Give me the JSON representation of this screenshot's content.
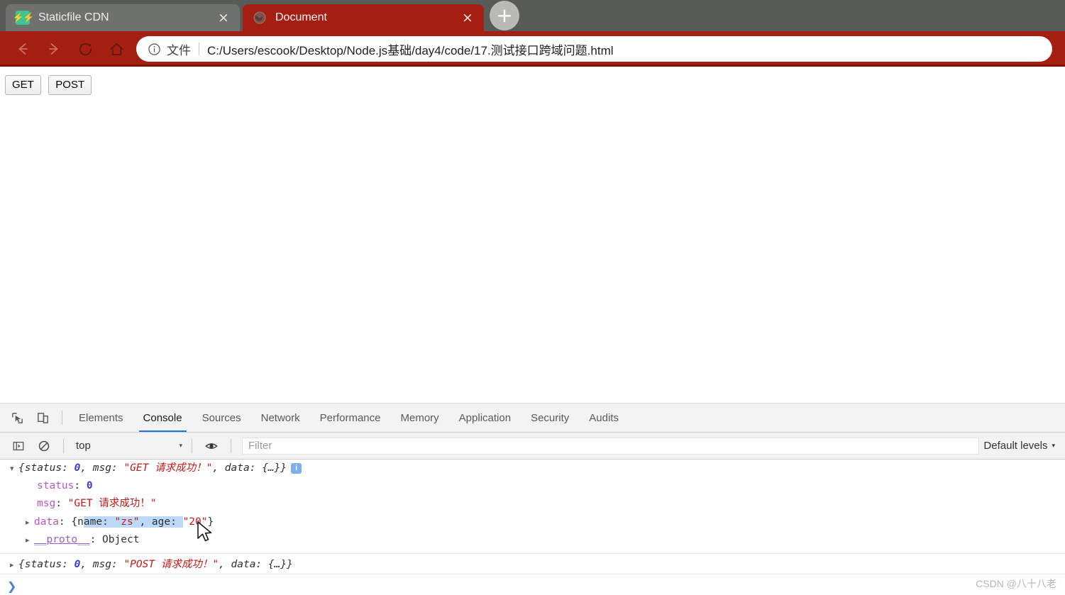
{
  "window": {
    "tabs": [
      {
        "title": "Staticfile CDN",
        "favicon": "lightning-icon",
        "active": false,
        "close_label": "×"
      },
      {
        "title": "Document",
        "favicon": "globe-icon",
        "active": true,
        "close_label": "×"
      }
    ],
    "new_tab_label": "+"
  },
  "toolbar": {
    "back_icon": "arrow-left-icon",
    "forward_icon": "arrow-right-icon",
    "reload_icon": "reload-icon",
    "home_icon": "home-icon",
    "omnibox": {
      "info_icon": "info-circle-icon",
      "scheme_label": "文件",
      "url": "C:/Users/escook/Desktop/Node.js基础/day4/code/17.测试接口跨域问题.html"
    }
  },
  "page": {
    "buttons": [
      {
        "label": "GET"
      },
      {
        "label": "POST"
      }
    ]
  },
  "devtools": {
    "inspect_icon": "inspect-element-icon",
    "device_icon": "device-toolbar-icon",
    "tabs": [
      {
        "label": "Elements",
        "active": false
      },
      {
        "label": "Console",
        "active": true
      },
      {
        "label": "Sources",
        "active": false
      },
      {
        "label": "Network",
        "active": false
      },
      {
        "label": "Performance",
        "active": false
      },
      {
        "label": "Memory",
        "active": false
      },
      {
        "label": "Application",
        "active": false
      },
      {
        "label": "Security",
        "active": false
      },
      {
        "label": "Audits",
        "active": false
      }
    ],
    "console_toolbar": {
      "sidebar_icon": "console-sidebar-icon",
      "clear_icon": "clear-console-icon",
      "context": "top",
      "context_caret": "▾",
      "eye_icon": "live-expression-eye-icon",
      "filter_placeholder": "Filter",
      "filter_value": "",
      "levels_label": "Default levels",
      "levels_caret": "▾"
    },
    "console": {
      "entry1": {
        "toggle": "▾",
        "preview_open": "{",
        "k_status": "status: ",
        "v_status": "0",
        "comma1": ", ",
        "k_msg": "msg: ",
        "v_msg": "\"GET 请求成功！\"",
        "comma2": ", ",
        "k_data": "data: ",
        "v_data": "{…}",
        "preview_close": "}",
        "badge": "i",
        "row_status_key": "status",
        "row_status_sep": ": ",
        "row_status_val": "0",
        "row_msg_key": "msg",
        "row_msg_sep": ": ",
        "row_msg_val": "\"GET 请求成功！\"",
        "row_data_toggle": "▸",
        "row_data_key": "data",
        "row_data_sep": ": ",
        "row_data_open": "{",
        "row_data_sel_a": "n",
        "row_data_sel_b": "ame: ",
        "row_data_sel_str": "\"zs\"",
        "row_data_sel_c": ", ",
        "row_data_sel_d": "age: ",
        "row_data_age": "\"20\"",
        "row_data_close": "}",
        "row_proto_toggle": "▸",
        "row_proto_key": "__proto__",
        "row_proto_sep": ": ",
        "row_proto_val": "Object"
      },
      "entry2": {
        "toggle": "▸",
        "preview_open": "{",
        "k_status": "status: ",
        "v_status": "0",
        "comma1": ", ",
        "k_msg": "msg: ",
        "v_msg": "\"POST 请求成功！\"",
        "comma2": ", ",
        "k_data": "data: ",
        "v_data": "{…}",
        "preview_close": "}"
      },
      "prompt": "❯"
    }
  },
  "watermark": "CSDN @八十八老",
  "colors": {
    "chrome_accent": "#a51e12",
    "tabstrip": "#575a56",
    "tab_inactive": "#6e716d",
    "devtools_active_tab_underline": "#1a73e8",
    "selection": "#bcd9f7"
  }
}
